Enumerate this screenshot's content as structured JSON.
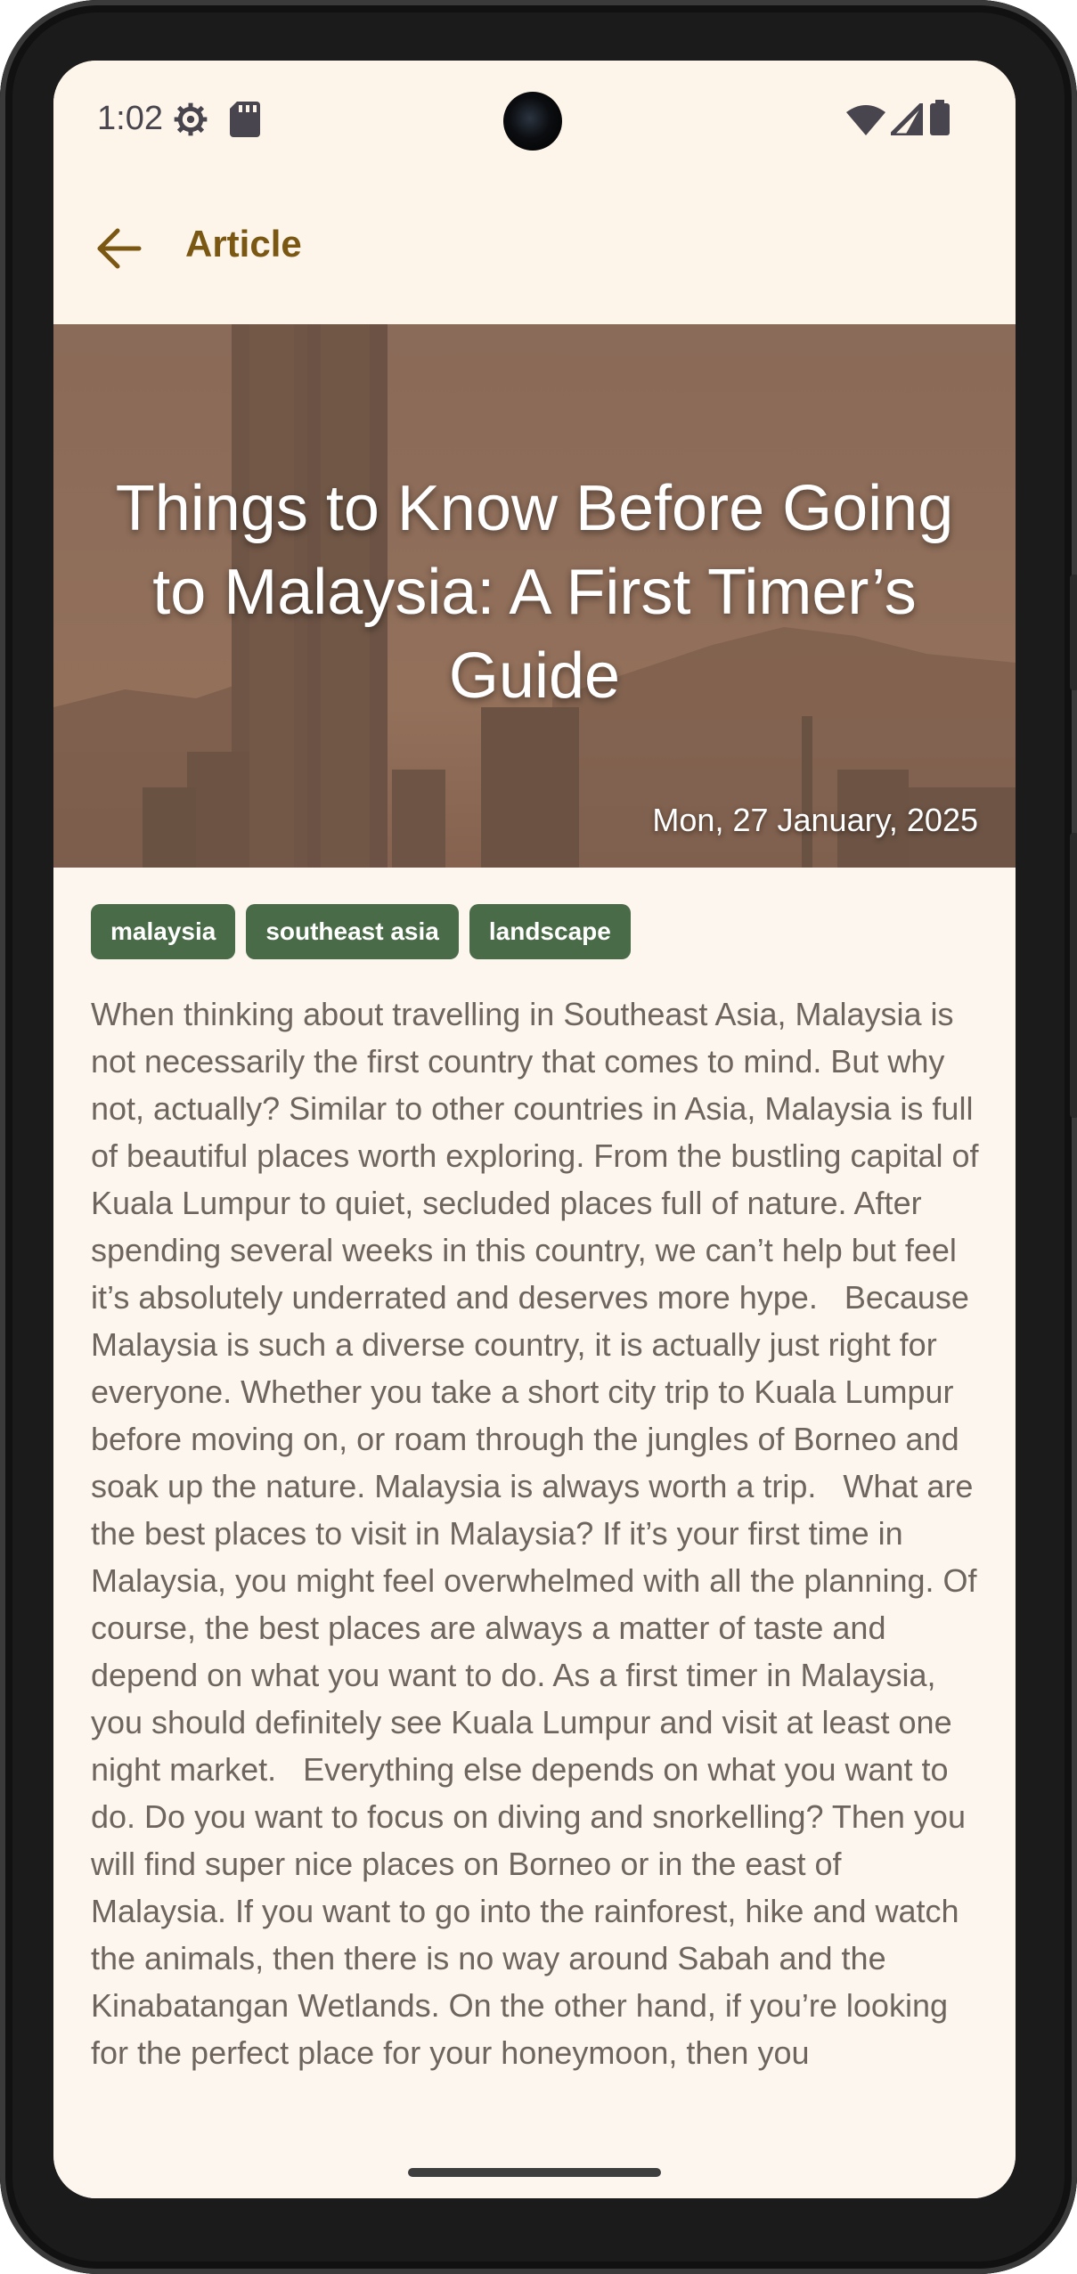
{
  "status_bar": {
    "time": "1:02",
    "left_icons": [
      "settings-gear-icon",
      "sd-card-icon"
    ],
    "right_icons": [
      "wifi-icon",
      "cell-signal-icon",
      "battery-icon"
    ]
  },
  "app_bar": {
    "title": "Article",
    "back_icon": "arrow-back-icon",
    "accent_color": "#7b5714"
  },
  "article": {
    "title": "Things to Know Before Going to Malaysia: A First Timer’s Guide",
    "date": "Mon, 27 January, 2025",
    "tags": [
      "malaysia",
      "southeast asia",
      "landscape"
    ],
    "tag_color": "#4a6b48",
    "body": "When thinking about travelling in Southeast Asia, Malaysia is not necessarily the first country that comes to mind. But why not, actually? Similar to other countries in Asia, Malaysia is full of beautiful places worth exploring. From the bustling capital of Kuala Lumpur to quiet, secluded places full of nature. After spending several weeks in this country, we can’t help but feel it’s absolutely underrated and deserves more hype.   Because Malaysia is such a diverse country, it is actually just right for everyone. Whether you take a short city trip to Kuala Lumpur before moving on, or roam through the jungles of Borneo and soak up the nature. Malaysia is always worth a trip.   What are the best places to visit in Malaysia? If it’s your first time in Malaysia, you might feel overwhelmed with all the planning. Of course, the best places are always a matter of taste and depend on what you want to do. As a first timer in Malaysia, you should definitely see Kuala Lumpur and visit at least one night market.   Everything else depends on what you want to do. Do you want to focus on diving and snorkelling? Then you will find super nice places on Borneo or in the east of Malaysia. If you want to go into the rainforest, hike and watch the animals, then there is no way around Sabah and the Kinabatangan Wetlands. On the other hand, if you’re looking for the perfect place for your honeymoon, then you"
  }
}
